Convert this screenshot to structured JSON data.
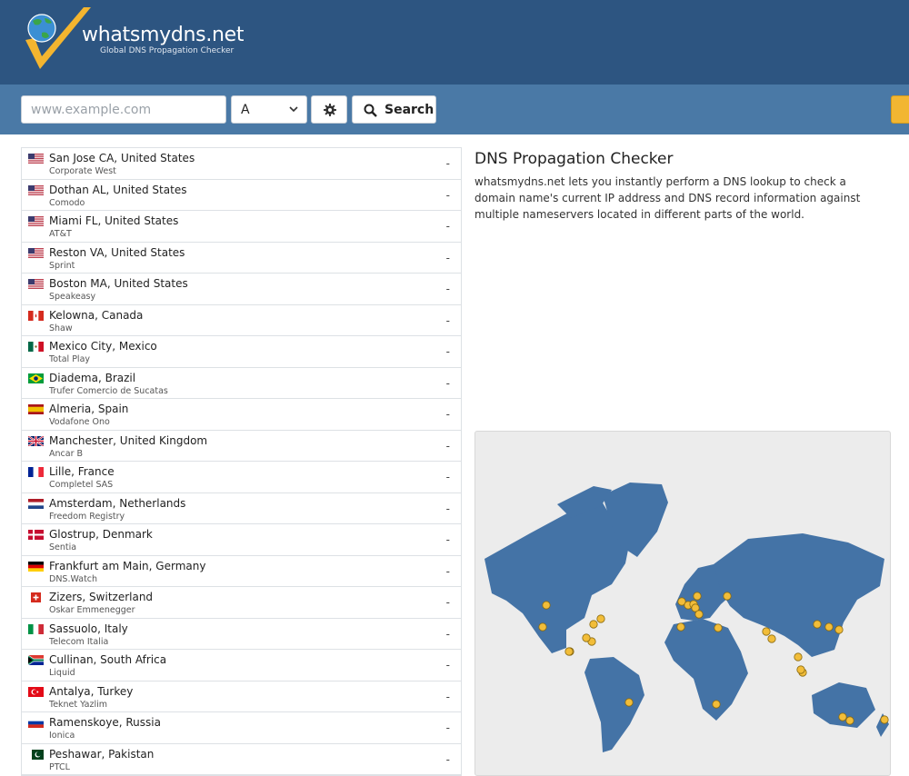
{
  "brand": {
    "name": "whatsmydns.net",
    "tagline": "Global DNS Propagation Checker"
  },
  "search": {
    "placeholder": "www.example.com",
    "record_type": "A",
    "button_label": "Search"
  },
  "intro": {
    "title": "DNS Propagation Checker",
    "text": "whatsmydns.net lets you instantly perform a DNS lookup to check a domain name's current IP address and DNS record information against multiple nameservers located in different parts of the world."
  },
  "servers": [
    {
      "location": "San Jose CA, United States",
      "provider": "Corporate West",
      "flag": "us",
      "result": "-"
    },
    {
      "location": "Dothan AL, United States",
      "provider": "Comodo",
      "flag": "us",
      "result": "-"
    },
    {
      "location": "Miami FL, United States",
      "provider": "AT&T",
      "flag": "us",
      "result": "-"
    },
    {
      "location": "Reston VA, United States",
      "provider": "Sprint",
      "flag": "us",
      "result": "-"
    },
    {
      "location": "Boston MA, United States",
      "provider": "Speakeasy",
      "flag": "us",
      "result": "-"
    },
    {
      "location": "Kelowna, Canada",
      "provider": "Shaw",
      "flag": "ca",
      "result": "-"
    },
    {
      "location": "Mexico City, Mexico",
      "provider": "Total Play",
      "flag": "mx",
      "result": "-"
    },
    {
      "location": "Diadema, Brazil",
      "provider": "Trufer Comercio de Sucatas",
      "flag": "br",
      "result": "-"
    },
    {
      "location": "Almeria, Spain",
      "provider": "Vodafone Ono",
      "flag": "es",
      "result": "-"
    },
    {
      "location": "Manchester, United Kingdom",
      "provider": "Ancar B",
      "flag": "gb",
      "result": "-"
    },
    {
      "location": "Lille, France",
      "provider": "Completel SAS",
      "flag": "fr",
      "result": "-"
    },
    {
      "location": "Amsterdam, Netherlands",
      "provider": "Freedom Registry",
      "flag": "nl",
      "result": "-"
    },
    {
      "location": "Glostrup, Denmark",
      "provider": "Sentia",
      "flag": "dk",
      "result": "-"
    },
    {
      "location": "Frankfurt am Main, Germany",
      "provider": "DNS.Watch",
      "flag": "de",
      "result": "-"
    },
    {
      "location": "Zizers, Switzerland",
      "provider": "Oskar Emmenegger",
      "flag": "ch",
      "result": "-"
    },
    {
      "location": "Sassuolo, Italy",
      "provider": "Telecom Italia",
      "flag": "it",
      "result": "-"
    },
    {
      "location": "Cullinan, South Africa",
      "provider": "Liquid",
      "flag": "za",
      "result": "-"
    },
    {
      "location": "Antalya, Turkey",
      "provider": "Teknet Yazlim",
      "flag": "tr",
      "result": "-"
    },
    {
      "location": "Ramenskoye, Russia",
      "provider": "Ionica",
      "flag": "ru",
      "result": "-"
    },
    {
      "location": "Peshawar, Pakistan",
      "provider": "PTCL",
      "flag": "pk",
      "result": "-"
    }
  ],
  "colors": {
    "header": "#2d5581",
    "searchbar": "#4a79a6",
    "map_land": "#4473a6",
    "map_bg": "#ececec",
    "marker": "#f2bd39"
  }
}
